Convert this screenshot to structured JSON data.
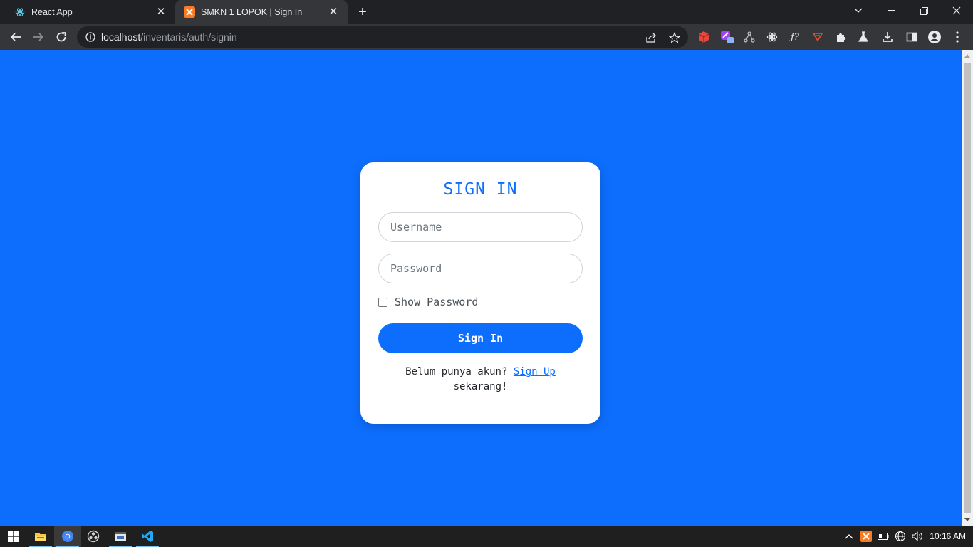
{
  "browser": {
    "tabs": [
      {
        "title": "React App",
        "icon": "react-icon",
        "active": false
      },
      {
        "title": "SMKN 1 LOPOK | Sign In",
        "icon": "xampp-icon",
        "active": true
      }
    ],
    "new_tab": "+",
    "url_host": "localhost",
    "url_path": "/inventaris/auth/signin",
    "extensions": [
      "cube-extension-icon",
      "color-picker-extension-icon",
      "graph-extension-icon",
      "react-devtools-icon",
      "formula-extension-icon",
      "save-extension-icon",
      "puzzle-icon",
      "flask-icon",
      "download-icon",
      "sidepanel-icon",
      "profile-icon",
      "more-menu-icon"
    ]
  },
  "colors": {
    "page_bg": "#0d6efd",
    "accent": "#0d6efd",
    "card_bg": "#ffffff"
  },
  "signin": {
    "title": "SIGN IN",
    "username_placeholder": "Username",
    "password_placeholder": "Password",
    "show_password_label": "Show Password",
    "show_password_checked": false,
    "submit_label": "Sign In",
    "footer_prefix": "Belum punya akun?",
    "footer_link": "Sign Up",
    "footer_suffix": "sekarang!"
  },
  "taskbar": {
    "apps": [
      "windows-start-icon",
      "file-explorer-icon",
      "chrome-icon",
      "obs-icon",
      "app-window-icon",
      "vscode-icon"
    ],
    "time": "10:16 AM"
  }
}
